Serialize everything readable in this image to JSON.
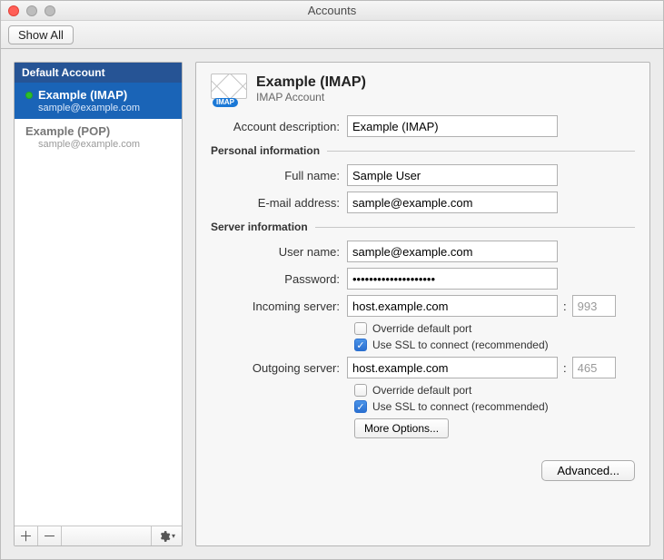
{
  "window": {
    "title": "Accounts"
  },
  "toolbar": {
    "show_all": "Show All"
  },
  "sidebar": {
    "header": "Default Account",
    "accounts": [
      {
        "name": "Example (IMAP)",
        "email": "sample@example.com",
        "selected": true,
        "online": true
      },
      {
        "name": "Example (POP)",
        "email": "sample@example.com",
        "selected": false,
        "online": false
      }
    ]
  },
  "header": {
    "title": "Example (IMAP)",
    "subtitle": "IMAP Account",
    "badge": "IMAP"
  },
  "labels": {
    "account_description": "Account description:",
    "personal_info": "Personal information",
    "full_name": "Full name:",
    "email": "E-mail address:",
    "server_info": "Server information",
    "user_name": "User name:",
    "password": "Password:",
    "incoming": "Incoming server:",
    "outgoing": "Outgoing server:",
    "override_port": "Override default port",
    "use_ssl": "Use SSL to connect (recommended)",
    "more_options": "More Options...",
    "advanced": "Advanced..."
  },
  "values": {
    "account_description": "Example (IMAP)",
    "full_name": "Sample User",
    "email": "sample@example.com",
    "user_name": "sample@example.com",
    "password": "••••••••••••••••••••",
    "incoming_server": "host.example.com",
    "incoming_port": "993",
    "incoming_override": false,
    "incoming_ssl": true,
    "outgoing_server": "host.example.com",
    "outgoing_port": "465",
    "outgoing_override": false,
    "outgoing_ssl": true
  }
}
